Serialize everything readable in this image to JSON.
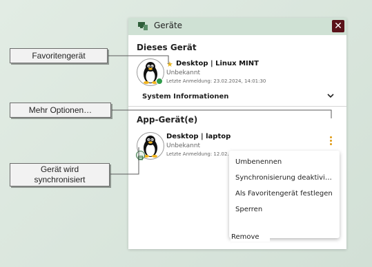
{
  "window": {
    "title": "Geräte",
    "close_glyph": "✕",
    "app_icon": "devices-icon"
  },
  "this_device": {
    "heading": "Dieses Gerät",
    "name": "Desktop | Linux MINT",
    "status": "Unbekannt",
    "last_login": "Letzte Anmeldung: 23.02.2024, 14:01:30",
    "favorite_icon": "star-icon",
    "favorite_color": "#e6b31e",
    "online_color": "#2f9b4a"
  },
  "system_info": {
    "label": "System Informationen",
    "toggle_icon": "chevron-down-icon"
  },
  "app_devices": {
    "heading": "App-Gerät(e)",
    "items": [
      {
        "name": "Desktop | laptop",
        "status": "Unbekannt",
        "last_login": "Letzte Anmeldung: 12.02.",
        "sync_icon": "sync-icon",
        "more_icon": "kebab-menu-icon"
      }
    ]
  },
  "context_menu": {
    "items": [
      "Umbenennen",
      "Synchronisierung deaktivi…",
      "Als Favoritengerät festlegen",
      "Sperren"
    ],
    "remove_label": "Remove"
  },
  "callouts": {
    "favorite": "Favoritengerät",
    "more_options": "Mehr Optionen…",
    "sync_line1": "Gerät wird",
    "sync_line2": "synchronisiert"
  },
  "colors": {
    "accent": "#e09a14",
    "titlebar": "#cfe1d4",
    "close_button": "#5a1219",
    "background": "#d8e4db"
  }
}
